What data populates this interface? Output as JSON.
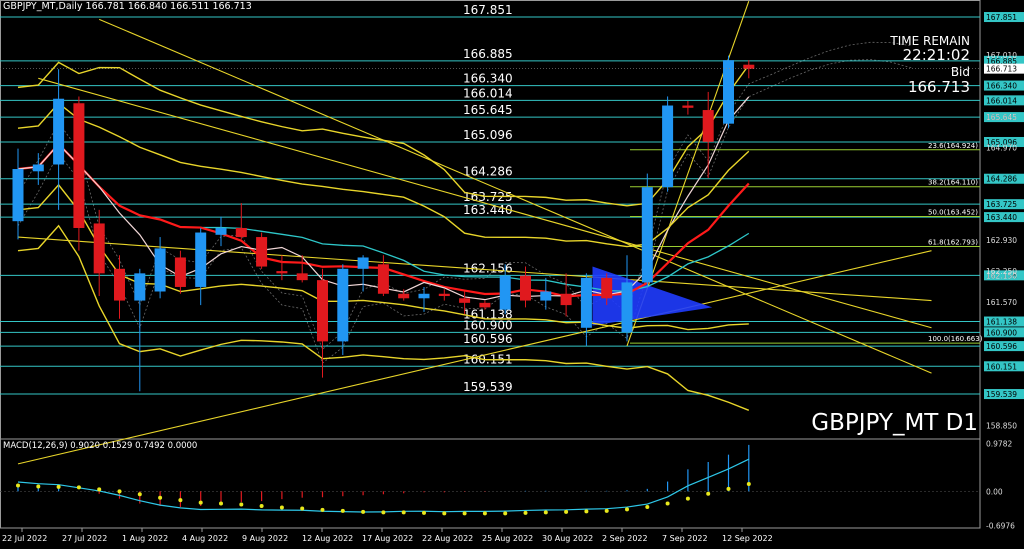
{
  "header": {
    "symbol_info": "GBPJPY_MT,Daily  166.781 166.840 166.511 166.713",
    "macd_label": "MACD(12,26,9) 0.9020 0.1529 0.7492 0.0000"
  },
  "panel": {
    "time_remain_label": "TIME REMAIN",
    "time_remain_value": "22:21:02",
    "bid_label": "Bid",
    "bid_value": "166.713",
    "watermark": "GBPJPY_MT D1"
  },
  "colors": {
    "bull": "#2196f3",
    "bear": "#e0191e",
    "bollinger": "#e8d52a",
    "ma_red": "#ff1a1a",
    "ma_cyan": "#2ec7c9",
    "ma_white": "#f0d6d6",
    "level_line": "#34c6c6",
    "fib_line": "#9acd32",
    "triangle": "#1f3cff",
    "macd_signal": "#e8e81c",
    "macd_line": "#2ec7e8"
  },
  "chart_data": [
    {
      "type": "candlestick",
      "x_ticks": [
        "22 Jul 2022",
        "27 Jul 2022",
        "1 Aug 2022",
        "4 Aug 2022",
        "9 Aug 2022",
        "12 Aug 2022",
        "17 Aug 2022",
        "22 Aug 2022",
        "25 Aug 2022",
        "30 Aug 2022",
        "2 Sep 2022",
        "7 Sep 2022",
        "12 Sep 2022"
      ],
      "y_ticks": [
        "167.010",
        "165.645",
        "164.970",
        "162.930",
        "162.250",
        "161.570",
        "158.850"
      ],
      "ylim": [
        158.57,
        168.05
      ],
      "candles": [
        {
          "o": 163.35,
          "h": 164.95,
          "l": 162.95,
          "c": 164.5
        },
        {
          "o": 164.45,
          "h": 164.85,
          "l": 164.15,
          "c": 164.6
        },
        {
          "o": 164.6,
          "h": 166.7,
          "l": 163.6,
          "c": 166.05
        },
        {
          "o": 165.95,
          "h": 166.1,
          "l": 162.7,
          "c": 163.2
        },
        {
          "o": 163.3,
          "h": 163.6,
          "l": 161.7,
          "c": 162.2
        },
        {
          "o": 162.3,
          "h": 162.6,
          "l": 161.2,
          "c": 161.6
        },
        {
          "o": 161.6,
          "h": 162.3,
          "l": 159.6,
          "c": 162.2
        },
        {
          "o": 161.8,
          "h": 163.0,
          "l": 161.65,
          "c": 162.75
        },
        {
          "o": 162.55,
          "h": 162.7,
          "l": 161.75,
          "c": 161.9
        },
        {
          "o": 161.9,
          "h": 163.2,
          "l": 161.5,
          "c": 163.1
        },
        {
          "o": 163.05,
          "h": 163.45,
          "l": 162.8,
          "c": 163.2
        },
        {
          "o": 163.2,
          "h": 163.75,
          "l": 162.95,
          "c": 163.0
        },
        {
          "o": 163.0,
          "h": 163.1,
          "l": 162.3,
          "c": 162.35
        },
        {
          "o": 162.25,
          "h": 162.6,
          "l": 162.05,
          "c": 162.2
        },
        {
          "o": 162.2,
          "h": 162.6,
          "l": 162.0,
          "c": 162.05
        },
        {
          "o": 162.05,
          "h": 162.3,
          "l": 159.9,
          "c": 160.7
        },
        {
          "o": 160.7,
          "h": 162.4,
          "l": 160.4,
          "c": 162.3
        },
        {
          "o": 162.3,
          "h": 162.6,
          "l": 161.8,
          "c": 162.55
        },
        {
          "o": 162.4,
          "h": 162.6,
          "l": 161.7,
          "c": 161.75
        },
        {
          "o": 161.75,
          "h": 161.85,
          "l": 161.6,
          "c": 161.65
        },
        {
          "o": 161.65,
          "h": 161.9,
          "l": 161.35,
          "c": 161.75
        },
        {
          "o": 161.75,
          "h": 161.85,
          "l": 161.6,
          "c": 161.7
        },
        {
          "o": 161.65,
          "h": 161.8,
          "l": 161.3,
          "c": 161.55
        },
        {
          "o": 161.55,
          "h": 161.6,
          "l": 161.4,
          "c": 161.45
        },
        {
          "o": 161.4,
          "h": 162.4,
          "l": 161.3,
          "c": 162.15
        },
        {
          "o": 162.15,
          "h": 162.35,
          "l": 161.45,
          "c": 161.6
        },
        {
          "o": 161.6,
          "h": 162.1,
          "l": 161.4,
          "c": 161.8
        },
        {
          "o": 161.75,
          "h": 162.2,
          "l": 161.25,
          "c": 161.5
        },
        {
          "o": 161.0,
          "h": 162.2,
          "l": 160.6,
          "c": 162.1
        },
        {
          "o": 162.1,
          "h": 162.2,
          "l": 161.5,
          "c": 161.65
        },
        {
          "o": 160.9,
          "h": 162.6,
          "l": 160.7,
          "c": 162.0
        },
        {
          "o": 162.0,
          "h": 164.4,
          "l": 161.9,
          "c": 164.1
        },
        {
          "o": 164.1,
          "h": 166.1,
          "l": 164.0,
          "c": 165.9
        },
        {
          "o": 165.9,
          "h": 166.0,
          "l": 165.7,
          "c": 165.85
        },
        {
          "o": 165.8,
          "h": 166.2,
          "l": 164.3,
          "c": 165.1
        },
        {
          "o": 165.5,
          "h": 167.0,
          "l": 165.4,
          "c": 166.9
        },
        {
          "o": 166.8,
          "h": 166.9,
          "l": 166.5,
          "c": 166.71
        }
      ],
      "level_lines": [
        {
          "value": 167.851,
          "label": "167.851"
        },
        {
          "value": 166.885,
          "label": "166.885"
        },
        {
          "value": 166.34,
          "label": "166.340"
        },
        {
          "value": 166.014,
          "label": "166.014"
        },
        {
          "value": 165.645,
          "label": "165.645"
        },
        {
          "value": 165.096,
          "label": "165.096"
        },
        {
          "value": 164.286,
          "label": "164.286"
        },
        {
          "value": 163.725,
          "label": "163.725"
        },
        {
          "value": 163.44,
          "label": "163.440"
        },
        {
          "value": 162.156,
          "label": "162.156"
        },
        {
          "value": 161.138,
          "label": "161.138"
        },
        {
          "value": 160.9,
          "label": "160.900"
        },
        {
          "value": 160.596,
          "label": "160.596"
        },
        {
          "value": 160.151,
          "label": "160.151"
        },
        {
          "value": 159.539,
          "label": "159.539"
        }
      ],
      "fib_levels": [
        {
          "value": 164.924,
          "label": "23.6(164.924)"
        },
        {
          "value": 164.11,
          "label": "38.2(164.110)"
        },
        {
          "value": 163.452,
          "label": "50.0(163.452)"
        },
        {
          "value": 162.793,
          "label": "61.8(162.793)"
        },
        {
          "value": 160.663,
          "label": "100.0(160.663)"
        }
      ],
      "current_price": {
        "value": 166.713,
        "label": "166.713"
      },
      "extra_axis_label": "162.150"
    },
    {
      "type": "macd",
      "title": "MACD(12,26,9) 0.9020 0.1529 0.7492 0.0000",
      "y_ticks": [
        "0.9782",
        "0.00",
        "-0.6976"
      ],
      "ylim": [
        -0.75,
        1.05
      ],
      "histogram": [
        0.15,
        0.12,
        0.1,
        0.0,
        -0.05,
        -0.15,
        -0.25,
        -0.3,
        -0.32,
        -0.3,
        -0.26,
        -0.22,
        -0.2,
        -0.16,
        -0.13,
        -0.12,
        -0.1,
        -0.08,
        -0.06,
        -0.04,
        -0.02,
        -0.02,
        -0.01,
        -0.01,
        0.0,
        0.01,
        0.01,
        0.0,
        0.01,
        0.01,
        0.02,
        0.05,
        0.2,
        0.45,
        0.6,
        0.75,
        0.95
      ],
      "signal": [
        0.12,
        0.1,
        0.09,
        0.08,
        0.04,
        0.0,
        -0.06,
        -0.13,
        -0.18,
        -0.23,
        -0.25,
        -0.27,
        -0.3,
        -0.33,
        -0.35,
        -0.38,
        -0.4,
        -0.42,
        -0.43,
        -0.43,
        -0.44,
        -0.45,
        -0.45,
        -0.45,
        -0.45,
        -0.44,
        -0.43,
        -0.42,
        -0.41,
        -0.4,
        -0.37,
        -0.32,
        -0.25,
        -0.15,
        -0.05,
        0.05,
        0.15
      ]
    }
  ]
}
